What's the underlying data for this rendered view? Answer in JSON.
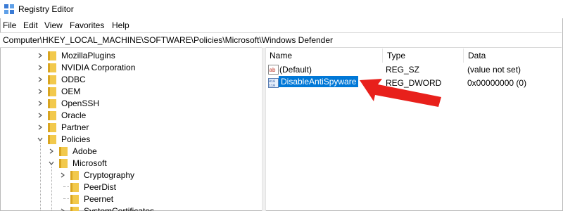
{
  "window": {
    "title": "Registry Editor"
  },
  "menu": [
    "File",
    "Edit",
    "View",
    "Favorites",
    "Help"
  ],
  "address": "Computer\\HKEY_LOCAL_MACHINE\\SOFTWARE\\Policies\\Microsoft\\Windows Defender",
  "tree": [
    {
      "label": "MozillaPlugins",
      "level": 0,
      "expanded": false
    },
    {
      "label": "NVIDIA Corporation",
      "level": 0,
      "expanded": false
    },
    {
      "label": "ODBC",
      "level": 0,
      "expanded": false
    },
    {
      "label": "OEM",
      "level": 0,
      "expanded": false
    },
    {
      "label": "OpenSSH",
      "level": 0,
      "expanded": false
    },
    {
      "label": "Oracle",
      "level": 0,
      "expanded": false
    },
    {
      "label": "Partner",
      "level": 0,
      "expanded": false
    },
    {
      "label": "Policies",
      "level": 0,
      "expanded": true
    },
    {
      "label": "Adobe",
      "level": 1,
      "expanded": false
    },
    {
      "label": "Microsoft",
      "level": 1,
      "expanded": true
    },
    {
      "label": "Cryptography",
      "level": 2,
      "expanded": false
    },
    {
      "label": "PeerDist",
      "level": 2,
      "expanded": null
    },
    {
      "label": "Peernet",
      "level": 2,
      "expanded": null
    },
    {
      "label": "SystemCertificates",
      "level": 2,
      "expanded": false
    }
  ],
  "columns": {
    "name": "Name",
    "type": "Type",
    "data": "Data"
  },
  "values": [
    {
      "name": "(Default)",
      "type": "REG_SZ",
      "data": "(value not set)",
      "icon": "string-value-icon",
      "selected": false
    },
    {
      "name": "DisableAntiSpyware",
      "type": "REG_DWORD",
      "data": "0x00000000 (0)",
      "icon": "dword-value-icon",
      "selected": true
    }
  ],
  "colors": {
    "folder": "#f2c94c",
    "folder_dark": "#d9a520",
    "selection": "#0078d7",
    "arrow": "#e8201b"
  }
}
